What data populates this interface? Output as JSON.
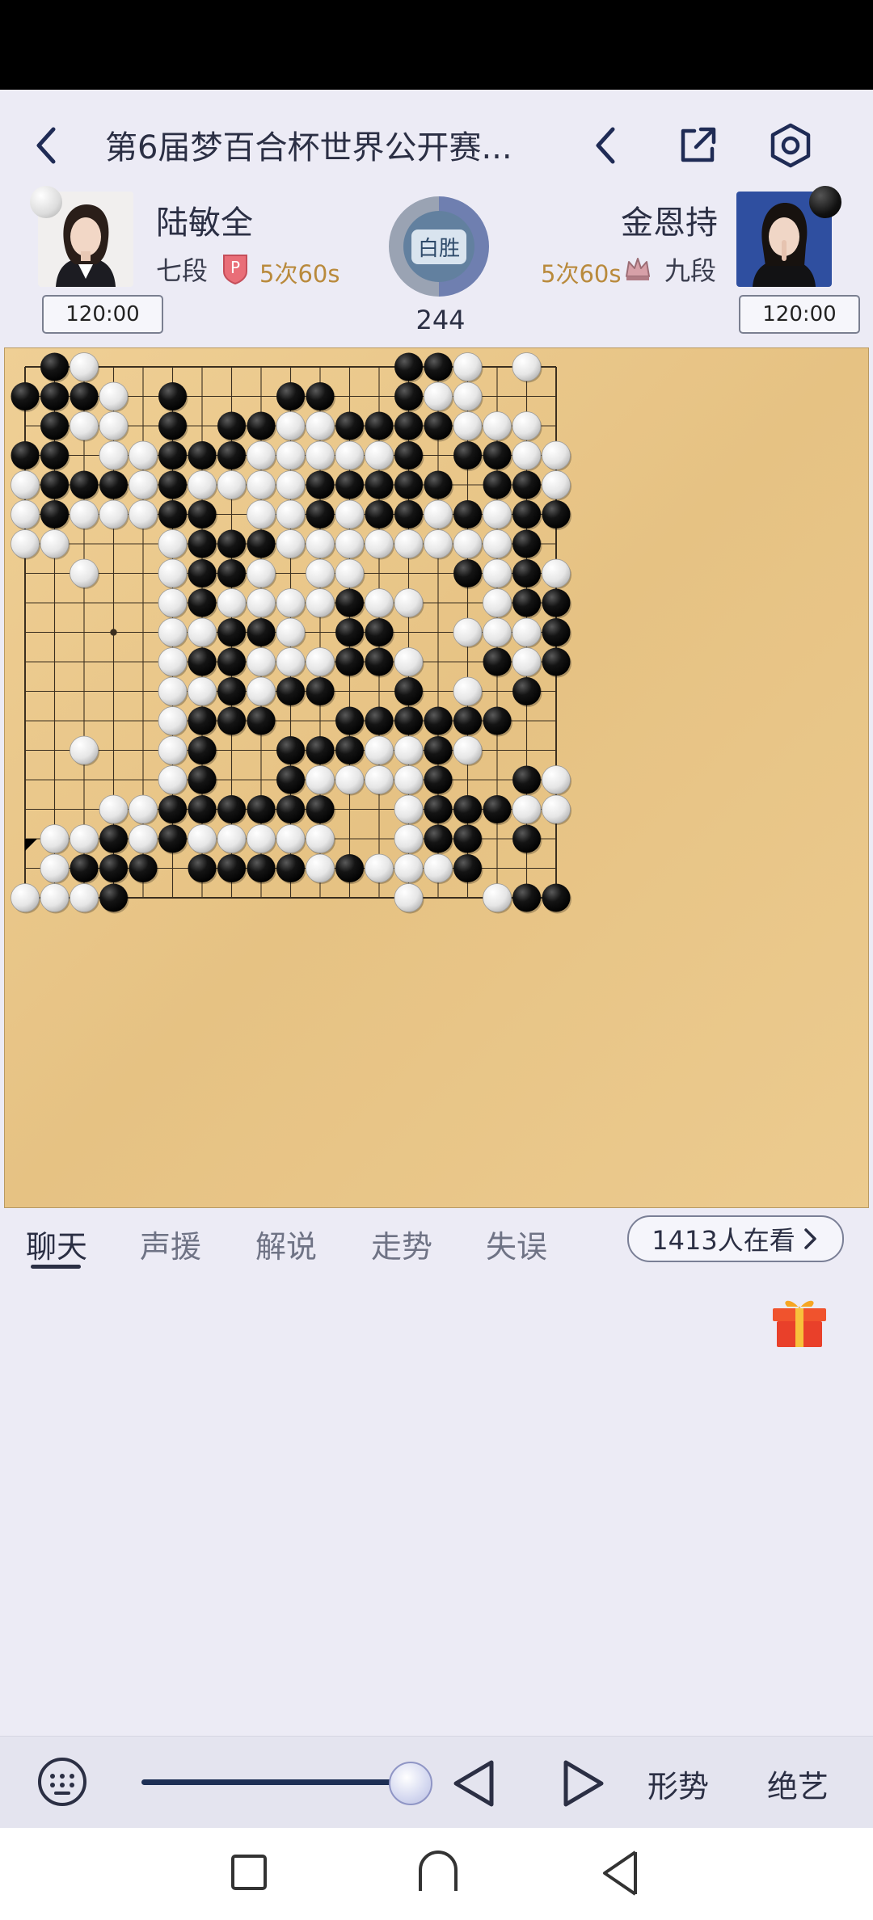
{
  "header": {
    "title": "第6届梦百合杯世界公开赛...",
    "icons": [
      "back-arrow-icon",
      "previous-icon",
      "share-icon",
      "settings-icon"
    ]
  },
  "players": {
    "left": {
      "name": "陆敏全",
      "rank": "七段",
      "rank_badge": "P",
      "byoyomi": "5次60s",
      "clock": "120:00",
      "stone": "white"
    },
    "right": {
      "name": "金恩持",
      "rank": "九段",
      "byoyomi": "5次60s",
      "clock": "120:00",
      "stone": "black"
    }
  },
  "result": {
    "label": "白胜",
    "move_count": "244"
  },
  "board": {
    "size": 19,
    "last_move": [
      16,
      0
    ],
    "rows": [
      ".BW..........BBW.W.",
      "BBBW.B...BB..BWW...",
      ".BWW.B.BBWWBBBBWWW.",
      "BB.WWBBBWWWWWB.BBWW",
      "WBBBWBWWWWBBBBB.BBW",
      "WBWWWBB.WWBWBBWBWBB",
      "WW...WBBBWWWWWWWWB.",
      "..W..WBBW.WW...BWBW",
      ".....WBWWWWBWW..WBB",
      ".....WWBBW.BB..WWWB",
      ".....WBBWWWBBW..BWB",
      ".....WWBWBB..B.W.B.",
      ".....WBBB..BBBBBB..",
      "..W..WB..BBBWWBW...",
      ".....WB..BWWWWB..BWB",
      "...WWBBBBBB..WBBBWW",
      ".WWBWBWWWWW..WBB.B.",
      ".WBBB.BBBBWBWWWB...",
      "WWWB.........W..WBB"
    ]
  },
  "tabs": [
    "聊天",
    "声援",
    "解说",
    "走势",
    "失误"
  ],
  "viewers": "1413人在看",
  "bottom": {
    "analysis_label": "形势",
    "ai_label": "绝艺",
    "slider_progress": 1.0
  },
  "colors": {
    "board": "#e8c588",
    "page_bg": "#ecebf5",
    "accent": "#1d2f55"
  }
}
